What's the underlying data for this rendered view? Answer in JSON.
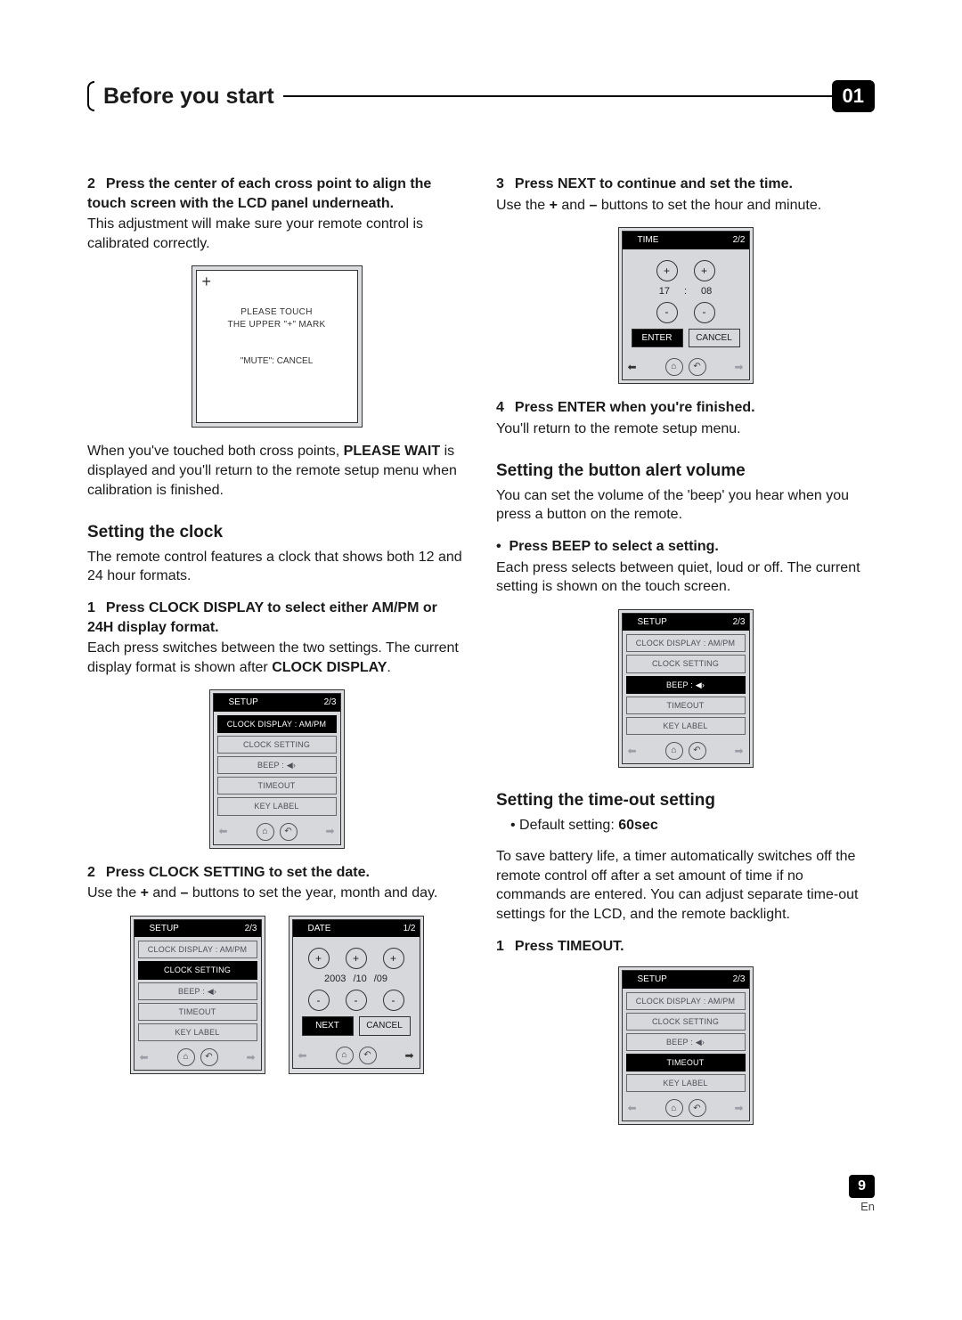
{
  "header": {
    "title": "Before you start",
    "chapter_num": "01"
  },
  "left": {
    "s2a": "2",
    "s2b": "Press the center of each cross point to align the touch screen with the LCD panel underneath.",
    "s2body": "This adjustment will make sure your remote control is calibrated correctly.",
    "calib": {
      "l1": "PLEASE TOUCH",
      "l2": "THE UPPER \"+\" MARK",
      "l3": "\"MUTE\": CANCEL"
    },
    "afterCalib1": "When you've touched both cross points, ",
    "afterCalibBold": "PLEASE WAIT",
    "afterCalib2": " is displayed and you'll return to the remote setup menu when calibration is finished.",
    "h2_clock": "Setting the clock",
    "clock_intro": "The remote control features a clock that shows both 12 and 24 hour formats.",
    "s1a": "1",
    "s1b": "Press CLOCK DISPLAY to select either AM/PM or 24H display format.",
    "s1body1": "Each press switches between the two settings. The current display format is shown after ",
    "s1bodyBold": "CLOCK DISPLAY",
    "s1body2": ".",
    "s2c_num": "2",
    "s2c": "Press CLOCK SETTING to set the date.",
    "s2c_body_a": "Use the ",
    "s2c_body_plus": "+",
    "s2c_body_b": " and ",
    "s2c_body_minus": "–",
    "s2c_body_c": " buttons to set the year, month and day."
  },
  "right": {
    "s3num": "3",
    "s3": "Press NEXT to continue and set the time.",
    "s3body_a": "Use the ",
    "s3body_plus": "+",
    "s3body_b": " and ",
    "s3body_minus": "–",
    "s3body_c": " buttons to set the hour and minute.",
    "s4num": "4",
    "s4": "Press ENTER when you're finished.",
    "s4body": "You'll return to the remote setup menu.",
    "h2_beep": "Setting the button alert volume",
    "beep_intro": "You can set the volume of the 'beep' you hear when you press a button on the remote.",
    "beep_bullet": "Press BEEP to select a setting.",
    "beep_body": "Each press selects between quiet, loud or off. The current setting is shown on the touch screen.",
    "h2_timeout": "Setting the time-out setting",
    "timeout_default_a": "Default setting: ",
    "timeout_default_b": "60sec",
    "timeout_body": "To save battery life, a timer automatically switches off the remote control off after a set amount of time if no commands are entered. You can adjust separate time-out settings for the LCD, and the remote backlight.",
    "timeout_s1num": "1",
    "timeout_s1": "Press TIMEOUT."
  },
  "setup_menu": {
    "title": "SETUP",
    "page": "2/3",
    "i1": "CLOCK DISPLAY : AM/PM",
    "i2": "CLOCK SETTING",
    "i3": "BEEP :  ◀›",
    "i4": "TIMEOUT",
    "i5": "KEY LABEL"
  },
  "date_panel": {
    "title": "DATE",
    "page": "1/2",
    "y": "2003",
    "m": "/10",
    "d": "/09",
    "next": "NEXT",
    "cancel": "CANCEL"
  },
  "time_panel": {
    "title": "TIME",
    "page": "2/2",
    "h": "17",
    "sep": ":",
    "min": "08",
    "enter": "ENTER",
    "cancel": "CANCEL"
  },
  "footer": {
    "page": "9",
    "lang": "En"
  }
}
